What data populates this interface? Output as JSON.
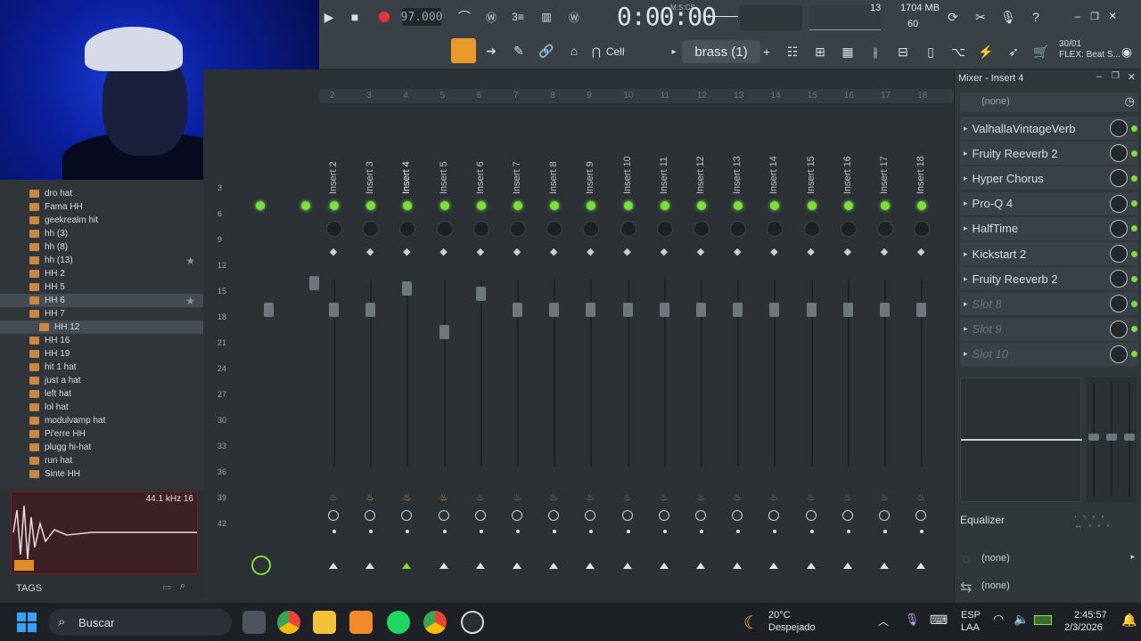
{
  "toolbar": {
    "tempo": "97.000",
    "time": "0:00:00",
    "time_unit": "M:S:CS",
    "cpu_voices": "13",
    "ram": "1704 MB",
    "polyphony": "60",
    "snap_label": "Cell",
    "pattern": "brass (1)",
    "news_date": "30/01",
    "news_text": "FLEX: Beat S..."
  },
  "browser": {
    "items": [
      "dro hat",
      "Fama HH",
      "geekrealm hit",
      "hh (3)",
      "hh (8)",
      "hh (13)",
      "HH 2",
      "HH 5",
      "HH 6",
      "HH 7",
      "HH 12",
      "HH 16",
      "HH 19",
      "hit 1 hat",
      "just a hat",
      "left hat",
      "lol hat",
      "modulvamp hat",
      "Pi'erre  HH",
      "plugg hi-hat",
      "run hat",
      "Sinte HH"
    ],
    "sample_rate": "44.1 kHz 16",
    "tags_label": "TAGS"
  },
  "mixer": {
    "ruler": [
      "2",
      "3",
      "4",
      "5",
      "6",
      "7",
      "8",
      "9",
      "10",
      "11",
      "12",
      "13",
      "14",
      "15",
      "16",
      "17",
      "18"
    ],
    "channels": [
      "Insert 2",
      "Insert 3",
      "Insert 4",
      "Insert 5",
      "Insert 6",
      "Insert 7",
      "Insert 8",
      "Insert 9",
      "Insert 10",
      "Insert 11",
      "Insert 12",
      "Insert 13",
      "Insert 14",
      "Insert 15",
      "Insert 16",
      "Insert 17",
      "Insert 18"
    ],
    "scale": [
      "3",
      "6",
      "9",
      "12",
      "15",
      "18",
      "21",
      "24",
      "27",
      "30",
      "33",
      "36",
      "39",
      "42"
    ]
  },
  "insert_panel": {
    "title": "Mixer - Insert 4",
    "preset": "(none)",
    "slots": [
      "ValhallaVintageVerb",
      "Fruity Reeverb 2",
      "Hyper Chorus",
      "Pro-Q 4",
      "HalfTime",
      "Kickstart 2",
      "Fruity Reeverb 2",
      "Slot 8",
      "Slot 9",
      "Slot 10"
    ],
    "eq_label": "Equalizer",
    "send_a": "(none)",
    "send_b": "(none)"
  },
  "taskbar": {
    "search": "Buscar",
    "temp": "20°C",
    "weather": "Despejado",
    "lang1": "ESP",
    "lang2": "LAA",
    "clock": "2:45:57",
    "date": "2/3/2026"
  },
  "colors": {
    "accent": "#7bde3a",
    "orange": "#e99a2a",
    "bg": "#2b3135"
  }
}
